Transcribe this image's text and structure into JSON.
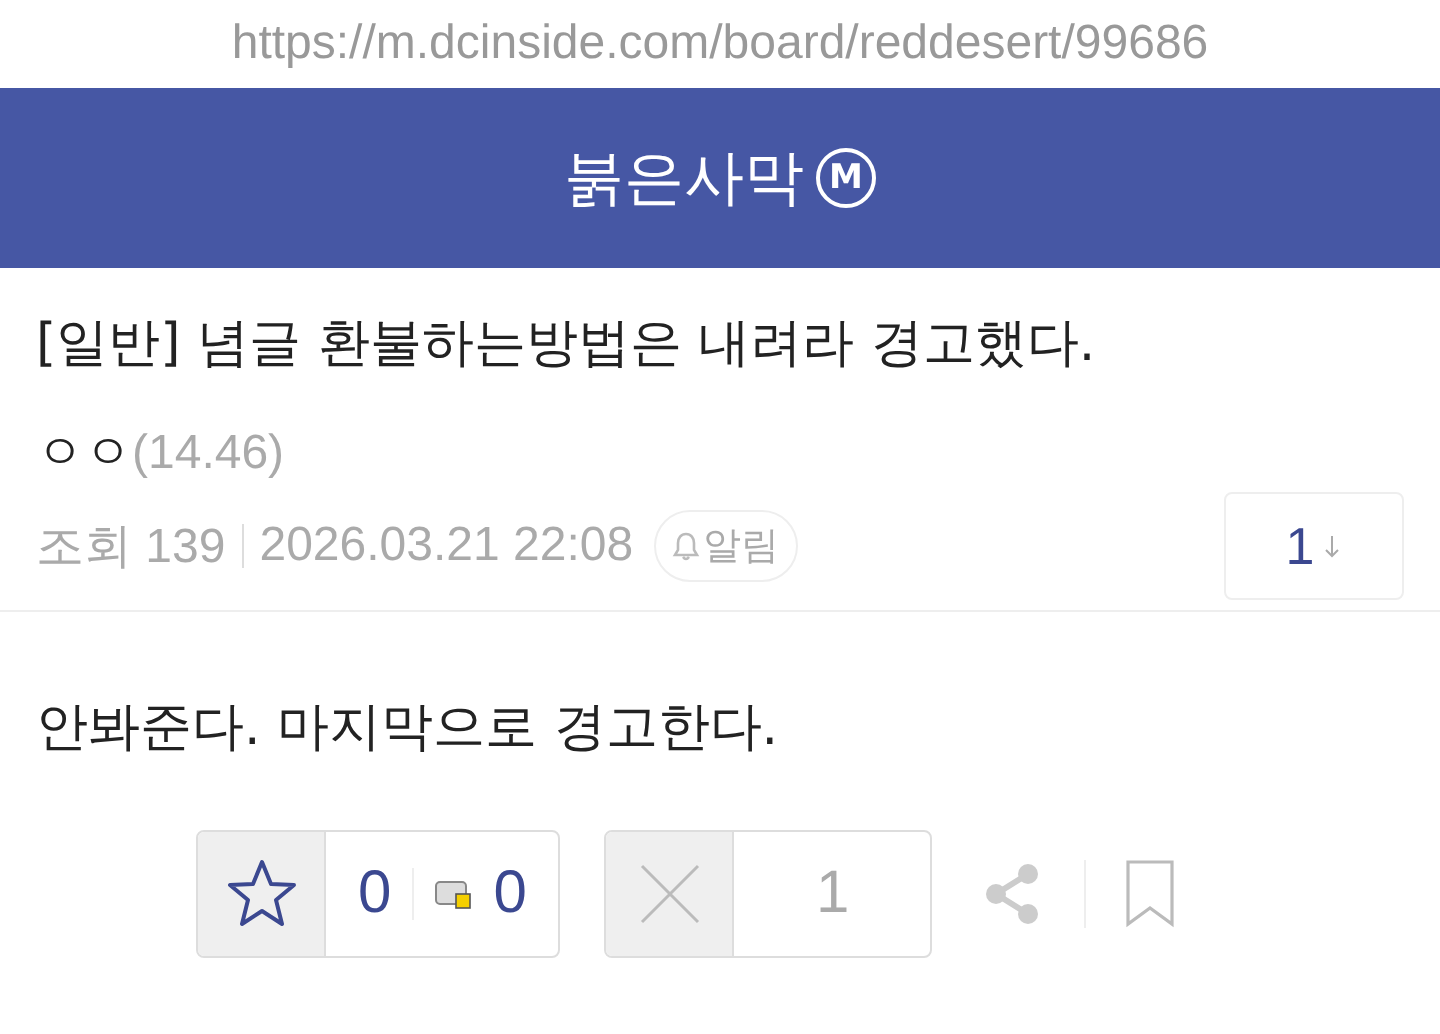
{
  "url": "https://m.dcinside.com/board/reddesert/99686",
  "header": {
    "title": "붉은사막",
    "badge": "M"
  },
  "post": {
    "title": "[일반] 념글 환불하는방법은 내려라 경고했다.",
    "author": "ㅇㅇ",
    "ip": "(14.46)",
    "views": "조회 139",
    "date": "2026.03.21 22:08",
    "alert": "알림",
    "comment_count": "1",
    "body": "안봐준다. 마지막으로 경고한다."
  },
  "actions": {
    "recommend": "0",
    "fix_recommend": "0",
    "downvote": "1"
  }
}
